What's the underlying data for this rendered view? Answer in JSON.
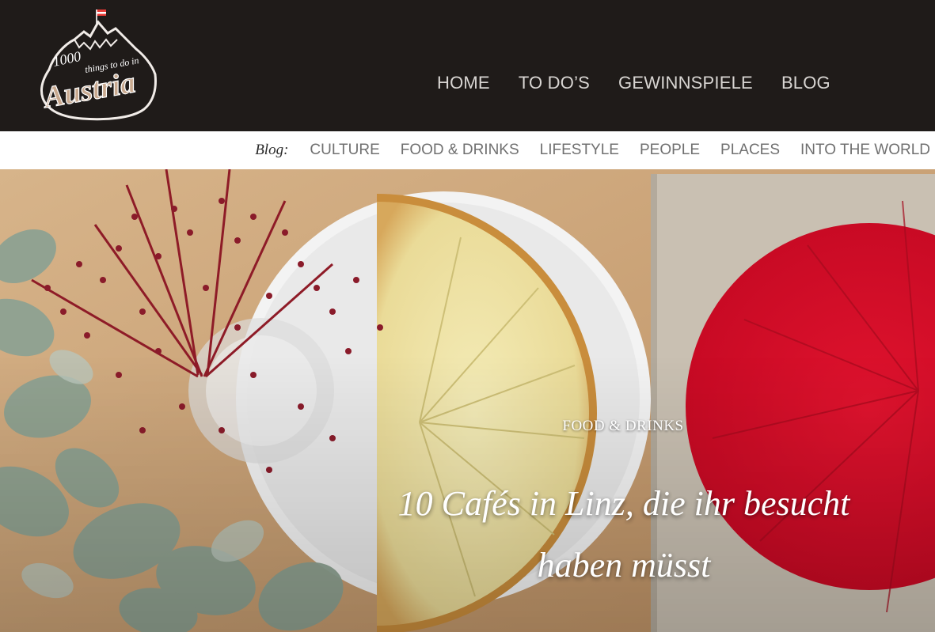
{
  "logo": {
    "line1": "1000",
    "line2": "things to do in",
    "line3": "Austria"
  },
  "main_nav": {
    "items": [
      {
        "label": "HOME"
      },
      {
        "label": "TO DO’S"
      },
      {
        "label": "GEWINNSPIELE"
      },
      {
        "label": "BLOG"
      }
    ]
  },
  "sub_nav": {
    "label": "Blog:",
    "items": [
      {
        "label": "CULTURE"
      },
      {
        "label": "FOOD & DRINKS"
      },
      {
        "label": "LIFESTYLE"
      },
      {
        "label": "PEOPLE"
      },
      {
        "label": "PLACES"
      },
      {
        "label": "INTO THE WORLD"
      }
    ]
  },
  "hero": {
    "category": "FOOD & DRINKS",
    "headline_line1": "10 Cafés in Linz, die ihr besucht",
    "headline_line2": "haben müsst"
  },
  "colors": {
    "header_bg": "#1f1b19",
    "nav_text": "#d9d6d3",
    "subnav_text": "#707070",
    "cheesecake": "#efe4a8",
    "raspberry_tart": "#d8102c",
    "table_wood": "#c9a177"
  }
}
